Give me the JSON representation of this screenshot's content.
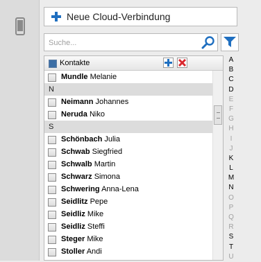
{
  "cloud_button": {
    "label": "Neue Cloud-Verbindung"
  },
  "search": {
    "placeholder": "Suche..."
  },
  "list": {
    "header_label": "Kontakte",
    "rows": [
      {
        "type": "contact",
        "last": "Mundle",
        "first": "Melanie"
      },
      {
        "type": "group",
        "label": "N"
      },
      {
        "type": "contact",
        "last": "Neimann",
        "first": "Johannes"
      },
      {
        "type": "contact",
        "last": "Neruda",
        "first": "Niko"
      },
      {
        "type": "group",
        "label": "S"
      },
      {
        "type": "contact",
        "last": "Schönbach",
        "first": "Julia"
      },
      {
        "type": "contact",
        "last": "Schwab",
        "first": "Siegfried"
      },
      {
        "type": "contact",
        "last": "Schwalb",
        "first": "Martin"
      },
      {
        "type": "contact",
        "last": "Schwarz",
        "first": "Simona"
      },
      {
        "type": "contact",
        "last": "Schwering",
        "first": "Anna-Lena"
      },
      {
        "type": "contact",
        "last": "Seidlitz",
        "first": "Pepe"
      },
      {
        "type": "contact",
        "last": "Seidliz",
        "first": "Mike"
      },
      {
        "type": "contact",
        "last": "Seidliz",
        "first": "Steffi"
      },
      {
        "type": "contact",
        "last": "Steger",
        "first": "Mike"
      },
      {
        "type": "contact",
        "last": "Stoller",
        "first": "Andi"
      }
    ]
  },
  "alpha_index": [
    {
      "letter": "A",
      "active": true
    },
    {
      "letter": "B",
      "active": true
    },
    {
      "letter": "C",
      "active": true
    },
    {
      "letter": "D",
      "active": true
    },
    {
      "letter": "E",
      "active": false
    },
    {
      "letter": "F",
      "active": false
    },
    {
      "letter": "G",
      "active": false
    },
    {
      "letter": "H",
      "active": false
    },
    {
      "letter": "I",
      "active": false
    },
    {
      "letter": "J",
      "active": false
    },
    {
      "letter": "K",
      "active": true
    },
    {
      "letter": "L",
      "active": true
    },
    {
      "letter": "M",
      "active": true
    },
    {
      "letter": "N",
      "active": true
    },
    {
      "letter": "O",
      "active": false
    },
    {
      "letter": "P",
      "active": false
    },
    {
      "letter": "Q",
      "active": false
    },
    {
      "letter": "R",
      "active": false
    },
    {
      "letter": "S",
      "active": true
    },
    {
      "letter": "T",
      "active": true
    },
    {
      "letter": "U",
      "active": false
    }
  ],
  "icons": {
    "device": "phone-icon",
    "add_cloud": "plus-icon",
    "search": "search-icon",
    "filter": "filter-icon",
    "add_contact": "add-icon",
    "delete_contact": "delete-icon"
  },
  "colors": {
    "accent": "#1f6fc0",
    "delete": "#d9272e",
    "group_bg": "#dcdcdc"
  }
}
